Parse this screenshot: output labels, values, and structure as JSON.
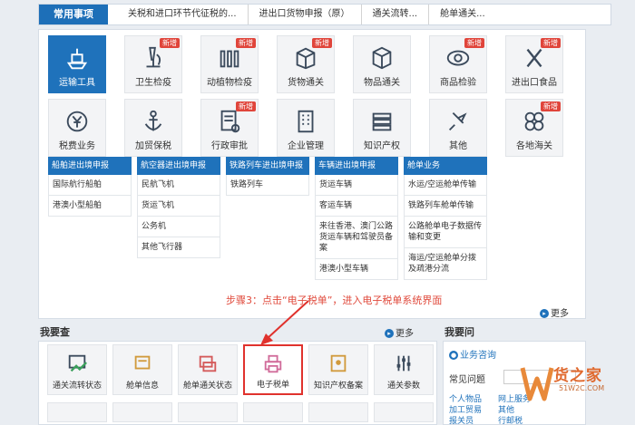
{
  "topbar": {
    "tag": "常用事项",
    "links": [
      "关税和进口环节代征税的...",
      "进出口货物申报（原）",
      "通关流转...",
      "舱单通关..."
    ]
  },
  "services": [
    {
      "label": "运输工具",
      "icon": "ship-icon",
      "active": true,
      "new": ""
    },
    {
      "label": "卫生检疫",
      "icon": "microscope-icon",
      "active": false,
      "new": "新增"
    },
    {
      "label": "动植物检疫",
      "icon": "fence-icon",
      "active": false,
      "new": "新增"
    },
    {
      "label": "货物通关",
      "icon": "cargo-box-icon",
      "active": false,
      "new": "新增"
    },
    {
      "label": "物品通关",
      "icon": "package-icon",
      "active": false,
      "new": ""
    },
    {
      "label": "商品检验",
      "icon": "eye-inspect-icon",
      "active": false,
      "new": "新增"
    },
    {
      "label": "进出口食品",
      "icon": "fork-knife-icon",
      "active": false,
      "new": "新增"
    },
    {
      "label": "税费业务",
      "icon": "yen-icon",
      "active": false,
      "new": ""
    },
    {
      "label": "加贸保税",
      "icon": "anchor-icon",
      "active": false,
      "new": ""
    },
    {
      "label": "行政审批",
      "icon": "approval-doc-icon",
      "active": false,
      "new": "新增"
    },
    {
      "label": "企业管理",
      "icon": "building-icon",
      "active": false,
      "new": ""
    },
    {
      "label": "知识产权",
      "icon": "books-icon",
      "active": false,
      "new": ""
    },
    {
      "label": "其他",
      "icon": "pin-icon",
      "active": false,
      "new": ""
    },
    {
      "label": "各地海关",
      "icon": "clover-icon",
      "active": false,
      "new": "新增"
    }
  ],
  "columns": [
    {
      "header": "船舶进出境申报",
      "items": [
        "国际航行船舶",
        "港澳小型船舶"
      ]
    },
    {
      "header": "航空器进出境申报",
      "items": [
        "民航飞机",
        "货运飞机",
        "公务机",
        "其他飞行器"
      ]
    },
    {
      "header": "铁路列车进出境申报",
      "items": [
        "铁路列车"
      ]
    },
    {
      "header": "车辆进出境申报",
      "items": [
        "货运车辆",
        "客运车辆",
        "来往香港、澳门公路货运车辆和驾驶员备案",
        "港澳小型车辆"
      ]
    },
    {
      "header": "舱单业务",
      "items": [
        "水运/空运舱单传输",
        "铁路列车舱单传输",
        "公路舱单电子数据传输和变更",
        "海运/空运舱单分拨及疏港分流"
      ]
    }
  ],
  "note": "步骤3：点击“电子税单”，进入电子税单系统界面",
  "more_label": "更多",
  "query": {
    "title": "我要查",
    "items": [
      {
        "label": "通关流转状态",
        "icon": "flow-status-icon"
      },
      {
        "label": "舱单信息",
        "icon": "manifest-icon"
      },
      {
        "label": "舱单通关状态",
        "icon": "manifest-status-icon"
      },
      {
        "label": "电子税单",
        "icon": "printer-icon"
      },
      {
        "label": "知识产权备案",
        "icon": "certificate-icon"
      },
      {
        "label": "通关参数",
        "icon": "sliders-icon"
      }
    ]
  },
  "ask": {
    "title": "我要问",
    "consult": "业务咨询",
    "faq": "常见问题",
    "mini_links": [
      "个人物品",
      "加工贸易",
      "报关员",
      "网上服务",
      "其他",
      "行邮税"
    ]
  },
  "watermark": {
    "main": "货之家",
    "sub": "51W2C.COM"
  },
  "colors": {
    "accent": "#1f72bb",
    "new_badge": "#e0453b",
    "note": "#e04a3c",
    "highlight_box": "#e0322d"
  }
}
